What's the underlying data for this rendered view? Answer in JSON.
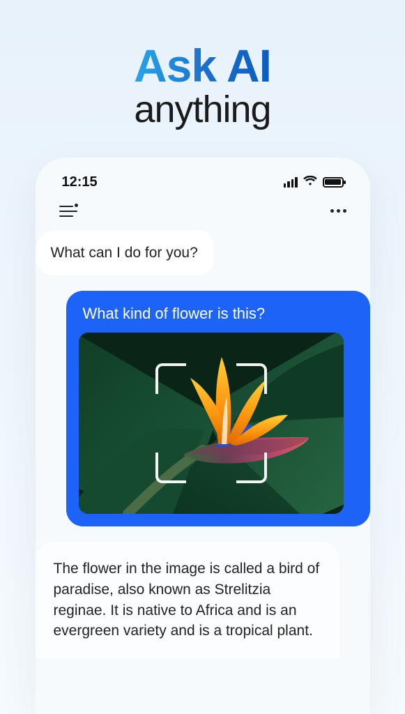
{
  "headline": {
    "top": "Ask AI",
    "bottom": "anything"
  },
  "status": {
    "time": "12:15"
  },
  "chat": {
    "greeting": "What can I do for you?",
    "user_question": "What kind of flower is this?",
    "answer": "The flower in the image is called a bird of paradise, also known as Strelitzia reginae. It is native to Africa and is an evergreen variety and is a tropical plant."
  }
}
